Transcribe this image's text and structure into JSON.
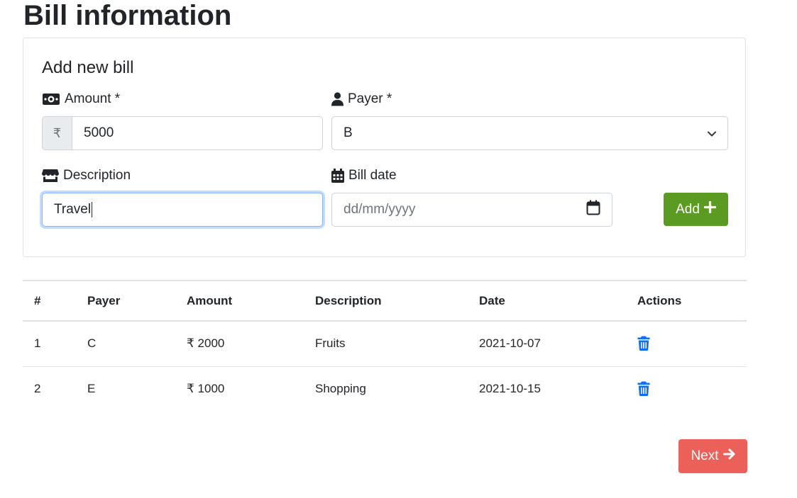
{
  "page": {
    "title": "Bill information"
  },
  "form": {
    "title": "Add new bill",
    "amount": {
      "label": "Amount *",
      "currency_symbol": "₹",
      "value": "5000"
    },
    "payer": {
      "label": "Payer *",
      "selected": "B"
    },
    "description": {
      "label": "Description",
      "value": "Travel"
    },
    "bill_date": {
      "label": "Bill date",
      "placeholder": "dd/mm/yyyy"
    },
    "add_button": {
      "label": "Add",
      "color": "#5c9b22"
    }
  },
  "table": {
    "headers": [
      "#",
      "Payer",
      "Amount",
      "Description",
      "Date",
      "Actions"
    ],
    "rows": [
      {
        "index": "1",
        "payer": "C",
        "amount": "₹ 2000",
        "description": "Fruits",
        "date": "2021-10-07",
        "action_icon": "trash-icon"
      },
      {
        "index": "2",
        "payer": "E",
        "amount": "₹ 1000",
        "description": "Shopping",
        "date": "2021-10-15",
        "action_icon": "trash-icon"
      }
    ]
  },
  "next_button": {
    "label": "Next",
    "color": "#ec605a"
  },
  "colors": {
    "link_icon": "#0d6efd",
    "focus_border": "#86b7fe"
  },
  "icons": {
    "amount": "money-bill-icon",
    "payer": "user-icon",
    "description": "store-icon",
    "bill_date": "calendar-icon",
    "add": "plus-icon",
    "next": "arrow-right-icon",
    "select": "chevron-down-icon"
  }
}
